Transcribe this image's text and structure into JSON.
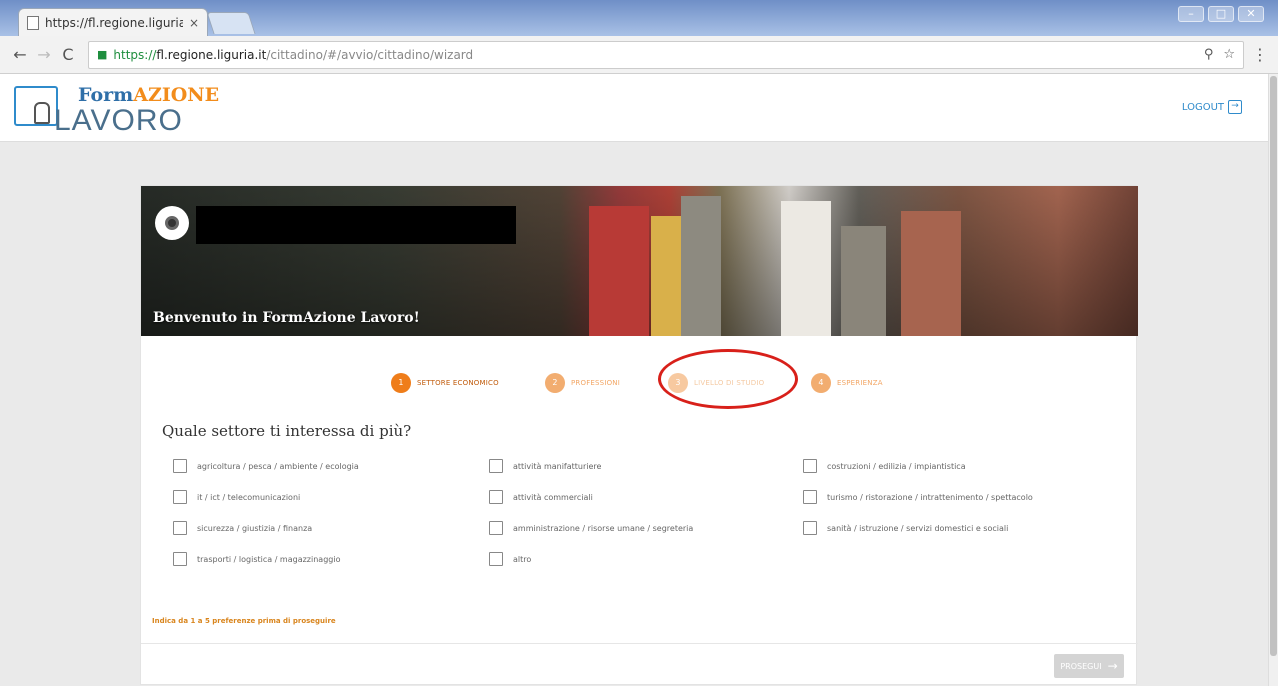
{
  "browser": {
    "tab_title": "https://fl.regione.liguria",
    "tab_close": "×",
    "url_secure": "https://",
    "url_host": "fl.regione.liguria.it",
    "url_path": "/cittadino/#/avvio/cittadino/wizard",
    "zoom_icon": "⚲",
    "star_icon": "☆",
    "menu_icon": "⋮",
    "back": "←",
    "forward": "→",
    "reload": "C",
    "lock": "🔒"
  },
  "header": {
    "logo_part1": "Form",
    "logo_part2": "AZIONE",
    "logo_bottom": "LAVORO",
    "logout_label": "LOGOUT"
  },
  "banner": {
    "welcome": "Benvenuto in FormAzione Lavoro!"
  },
  "steps": [
    {
      "num": "1",
      "label": "SETTORE ECONOMICO"
    },
    {
      "num": "2",
      "label": "PROFESSIONI"
    },
    {
      "num": "3",
      "label": "LIVELLO DI STUDIO"
    },
    {
      "num": "4",
      "label": "ESPERIENZA"
    }
  ],
  "question": "Quale settore ti interessa di più?",
  "options": [
    "agricoltura / pesca / ambiente / ecologia",
    "attività manifatturiere",
    "costruzioni / edilizia / impiantistica",
    "it / ict / telecomunicazioni",
    "attività commerciali",
    "turismo / ristorazione / intrattenimento / spettacolo",
    "sicurezza / giustizia / finanza",
    "amministrazione / risorse umane / segreteria",
    "sanità / istruzione / servizi domestici e sociali",
    "trasporti / logistica / magazzinaggio",
    "altro"
  ],
  "hint": "Indica da 1 a 5 preferenze prima di proseguire",
  "next_label": "PROSEGUI",
  "next_arrow": "→",
  "colors": {
    "accent_orange": "#ef7d1a",
    "brand_blue": "#2f8bcb",
    "highlight_red": "#d8201a"
  }
}
